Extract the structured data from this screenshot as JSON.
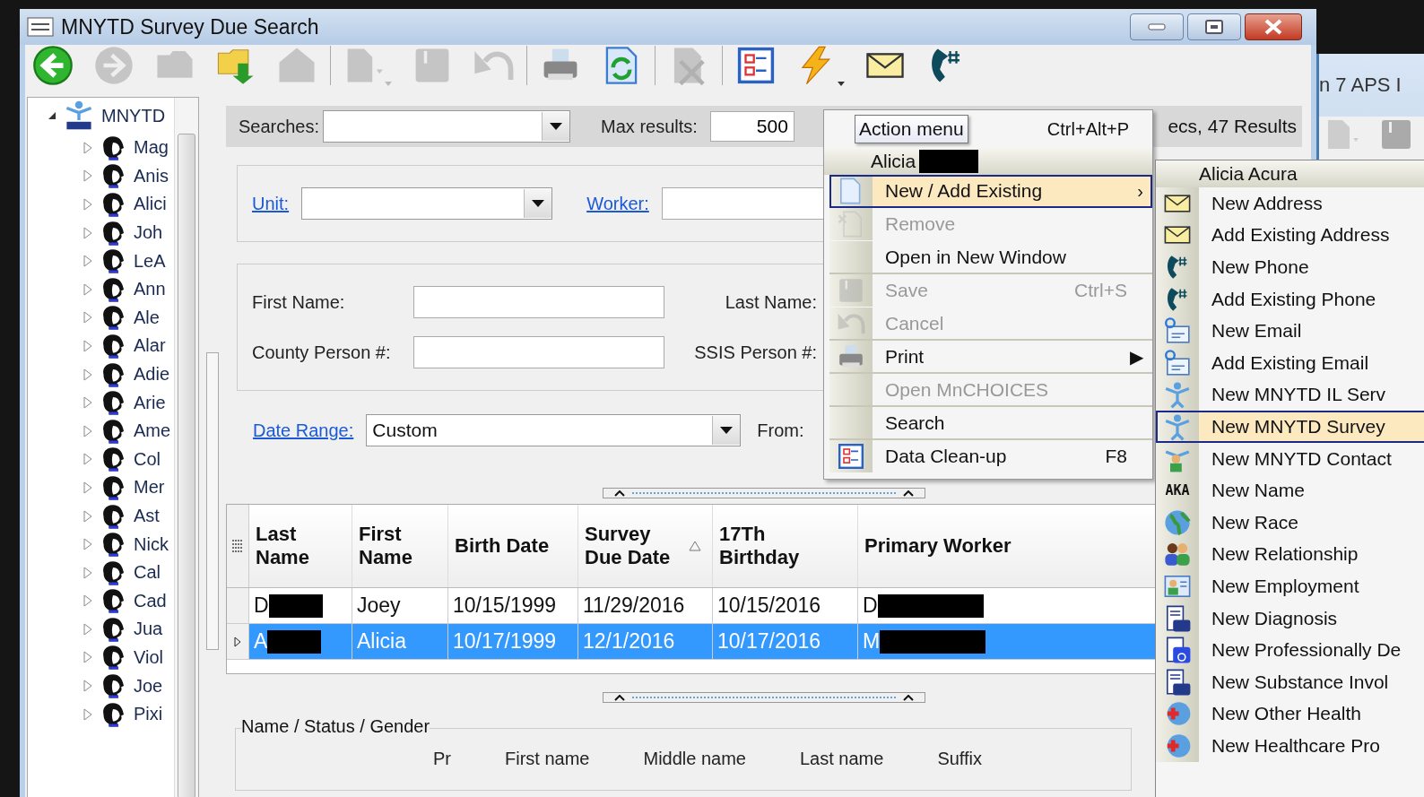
{
  "window": {
    "title": "MNYTD Survey Due Search"
  },
  "toolbar": [
    {
      "kind": "back",
      "disabled": false
    },
    {
      "kind": "forward",
      "disabled": true
    },
    {
      "kind": "folder",
      "disabled": true
    },
    {
      "kind": "folder-arrow",
      "disabled": false
    },
    {
      "kind": "house",
      "disabled": true
    },
    {
      "kind": "new",
      "disabled": true,
      "dropdown": true
    },
    {
      "kind": "save",
      "disabled": true
    },
    {
      "kind": "undo",
      "disabled": true
    },
    {
      "kind": "print",
      "disabled": false
    },
    {
      "kind": "refresh",
      "disabled": false
    },
    {
      "kind": "delete",
      "disabled": true
    },
    {
      "kind": "checklist",
      "disabled": false
    },
    {
      "kind": "action",
      "disabled": false,
      "dropdown": true
    },
    {
      "kind": "mail",
      "disabled": false
    },
    {
      "kind": "phone",
      "disabled": false
    }
  ],
  "tree": {
    "root": "MNYTD",
    "expanded": true,
    "children": [
      {
        "label": "Mag",
        "expanded": false
      },
      {
        "label": "Anis",
        "expanded": false
      },
      {
        "label": "Alici",
        "expanded": false
      },
      {
        "label": "Joh",
        "expanded": false
      },
      {
        "label": "LeA",
        "expanded": false
      },
      {
        "label": "Ann",
        "expanded": false
      },
      {
        "label": "Ale",
        "expanded": false
      },
      {
        "label": "Alar",
        "expanded": false
      },
      {
        "label": "Adie",
        "expanded": false
      },
      {
        "label": "Arie",
        "expanded": false
      },
      {
        "label": "Ame",
        "expanded": false
      },
      {
        "label": "Col",
        "expanded": false
      },
      {
        "label": "Mer",
        "expanded": false
      },
      {
        "label": "Ast",
        "expanded": false
      },
      {
        "label": "Nick",
        "expanded": false
      },
      {
        "label": "Cal",
        "expanded": false
      },
      {
        "label": "Cad",
        "expanded": false
      },
      {
        "label": "Jua",
        "expanded": false
      },
      {
        "label": "Viol",
        "expanded": false
      },
      {
        "label": "Joe",
        "expanded": false
      },
      {
        "label": "Pixi",
        "expanded": false
      }
    ]
  },
  "search_bar": {
    "searches_label": "Searches:",
    "max_results_label": "Max results:",
    "max_results_value": "500",
    "status": "ecs, 47 Results"
  },
  "filters": {
    "unit_label": "Unit:",
    "worker_label": "Worker:",
    "first_name_label": "First Name:",
    "last_name_label": "Last Name:",
    "county_label": "County Person #:",
    "ssis_label": "SSIS Person #:",
    "date_range_label": "Date Range:",
    "date_range_value": "Custom",
    "from_label": "From:"
  },
  "table": {
    "columns": [
      {
        "label": "Last Name",
        "sorted": false
      },
      {
        "label": "First Name",
        "sorted": false
      },
      {
        "label": "Birth Date",
        "sorted": false
      },
      {
        "label": "Survey Due Date",
        "sorted": true
      },
      {
        "label": "17Th Birthday",
        "sorted": false
      },
      {
        "label": "Primary Worker",
        "sorted": false
      }
    ],
    "rows": [
      {
        "selected": false,
        "cells": [
          {
            "text": "D",
            "redacted": true
          },
          {
            "text": "Joey",
            "redacted": false
          },
          {
            "text": "10/15/1999",
            "redacted": false
          },
          {
            "text": "11/29/2016",
            "redacted": false
          },
          {
            "text": "10/15/2016",
            "redacted": false
          },
          {
            "text": "D",
            "redacted": true
          }
        ]
      },
      {
        "selected": true,
        "cells": [
          {
            "text": "A",
            "redacted": true
          },
          {
            "text": "Alicia",
            "redacted": false
          },
          {
            "text": "10/17/1999",
            "redacted": false
          },
          {
            "text": "12/1/2016",
            "redacted": false
          },
          {
            "text": "10/17/2016",
            "redacted": false
          },
          {
            "text": "M",
            "redacted": true
          }
        ]
      }
    ]
  },
  "name_group": {
    "title": "Name / Status / Gender",
    "columns": [
      "Pr",
      "First name",
      "Middle name",
      "Last name",
      "Suffix"
    ]
  },
  "action_menu": {
    "tooltip": "Action menu",
    "shortcut": "Ctrl+Alt+P",
    "header": "Alicia",
    "header_redacted": true,
    "items": [
      {
        "label": "New / Add Existing",
        "kind": "document",
        "disabled": false,
        "selected": true,
        "arrow": "›",
        "divider": false
      },
      {
        "label": "Remove",
        "kind": "remove",
        "disabled": true,
        "selected": false,
        "divider": false
      },
      {
        "label": "Open in New Window",
        "kind": "none",
        "disabled": false,
        "selected": false,
        "divider": true
      },
      {
        "label": "Save",
        "kind": "save",
        "shortcut": "Ctrl+S",
        "disabled": true,
        "selected": false,
        "divider": false
      },
      {
        "label": "Cancel",
        "kind": "undo",
        "disabled": true,
        "selected": false,
        "divider": true
      },
      {
        "label": "Print",
        "kind": "print",
        "disabled": false,
        "selected": false,
        "arrow": "▶",
        "divider": true
      },
      {
        "label": "Open MnCHOICES",
        "kind": "none",
        "disabled": true,
        "selected": false,
        "divider": true
      },
      {
        "label": "Search",
        "kind": "none",
        "disabled": false,
        "selected": false,
        "divider": true
      },
      {
        "label": "Data Clean-up",
        "kind": "checklist",
        "shortcut": "F8",
        "disabled": false,
        "selected": false,
        "divider": false
      }
    ]
  },
  "submenu": {
    "header": "Alicia Acura",
    "items": [
      {
        "label": "New Address",
        "kind": "mail",
        "selected": false
      },
      {
        "label": "Add Existing Address",
        "kind": "mail",
        "selected": false
      },
      {
        "label": "New Phone",
        "kind": "phone",
        "selected": false
      },
      {
        "label": "Add Existing Phone",
        "kind": "phone",
        "selected": false
      },
      {
        "label": "New Email",
        "kind": "email",
        "selected": false
      },
      {
        "label": "Add Existing Email",
        "kind": "email",
        "selected": false
      },
      {
        "label": "New MNYTD IL Serv",
        "kind": "person",
        "selected": false
      },
      {
        "label": "New MNYTD Survey",
        "kind": "person",
        "selected": true
      },
      {
        "label": "New MNYTD Contact",
        "kind": "person-green",
        "selected": false
      },
      {
        "label": "New Name",
        "kind": "aka",
        "badge": "AKA",
        "selected": false
      },
      {
        "label": "New Race",
        "kind": "globe",
        "selected": false
      },
      {
        "label": "New Relationship",
        "kind": "people",
        "selected": false
      },
      {
        "label": "New Employment",
        "kind": "card",
        "selected": false
      },
      {
        "label": "New Diagnosis",
        "kind": "doc-blue",
        "selected": false
      },
      {
        "label": "New Professionally De",
        "kind": "doc-wheel",
        "selected": false
      },
      {
        "label": "New Substance Invol",
        "kind": "doc-blue",
        "selected": false
      },
      {
        "label": "New Other Health",
        "kind": "health",
        "selected": false
      },
      {
        "label": "New Healthcare Pro",
        "kind": "health",
        "selected": false
      }
    ]
  },
  "background_window": {
    "title": "n 7 APS I"
  }
}
